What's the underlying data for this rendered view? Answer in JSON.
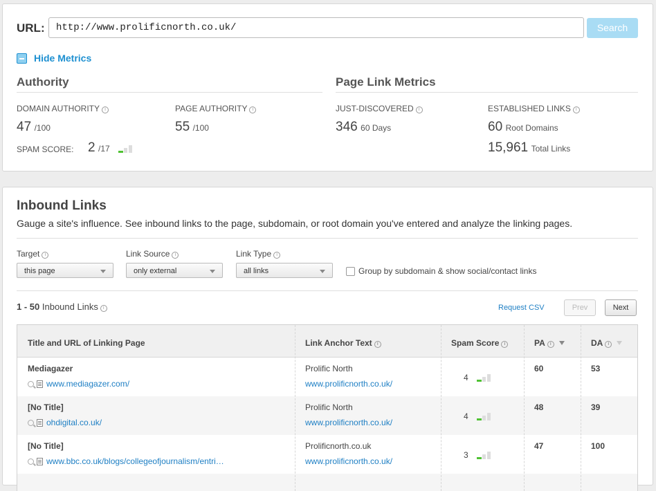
{
  "url_bar": {
    "label": "URL:",
    "value": "http://www.prolificnorth.co.uk/",
    "search_label": "Search"
  },
  "metrics_toggle": {
    "label": "Hide Metrics"
  },
  "authority": {
    "title": "Authority",
    "domain_authority": {
      "label": "DOMAIN AUTHORITY",
      "value": "47",
      "suffix": "/100"
    },
    "page_authority": {
      "label": "PAGE AUTHORITY",
      "value": "55",
      "suffix": "/100"
    },
    "spam_score": {
      "label": "SPAM SCORE:",
      "value": "2",
      "suffix": "/17"
    }
  },
  "page_link_metrics": {
    "title": "Page Link Metrics",
    "just_discovered": {
      "label": "JUST-DISCOVERED",
      "value": "346",
      "suffix": "60 Days"
    },
    "established_links": {
      "label": "ESTABLISHED LINKS",
      "root_domains_value": "60",
      "root_domains_label": "Root Domains",
      "total_links_value": "15,961",
      "total_links_label": "Total Links"
    }
  },
  "inbound": {
    "title": "Inbound Links",
    "subtitle": "Gauge a site's influence. See inbound links to the page, subdomain, or root domain you've entered and analyze the linking pages.",
    "filters": {
      "target": {
        "label": "Target",
        "value": "this page"
      },
      "link_source": {
        "label": "Link Source",
        "value": "only external"
      },
      "link_type": {
        "label": "Link Type",
        "value": "all links"
      },
      "group_checkbox_label": "Group by subdomain & show social/contact links"
    },
    "count_range": "1 - 50",
    "count_label": "Inbound Links",
    "request_csv": "Request CSV",
    "prev_label": "Prev",
    "next_label": "Next",
    "columns": {
      "title_url": "Title and URL of Linking Page",
      "anchor": "Link Anchor Text",
      "spam": "Spam Score",
      "pa": "PA",
      "da": "DA"
    },
    "rows": [
      {
        "title": "Mediagazer",
        "url": "www.mediagazer.com/",
        "anchor_text": "Prolific North",
        "anchor_url": "www.prolificnorth.co.uk/",
        "spam": "4",
        "pa": "60",
        "da": "53"
      },
      {
        "title": "[No Title]",
        "url": "ohdigital.co.uk/",
        "anchor_text": "Prolific North",
        "anchor_url": "www.prolificnorth.co.uk/",
        "spam": "4",
        "pa": "48",
        "da": "39"
      },
      {
        "title": "[No Title]",
        "url": "www.bbc.co.uk/blogs/collegeofjournalism/entri…",
        "anchor_text": "Prolificnorth.co.uk",
        "anchor_url": "www.prolificnorth.co.uk/",
        "spam": "3",
        "pa": "47",
        "da": "100"
      }
    ]
  },
  "colors": {
    "accent": "#1e90d1",
    "spam_bar": "#4fc233",
    "search_button": "#a9dcf4"
  }
}
